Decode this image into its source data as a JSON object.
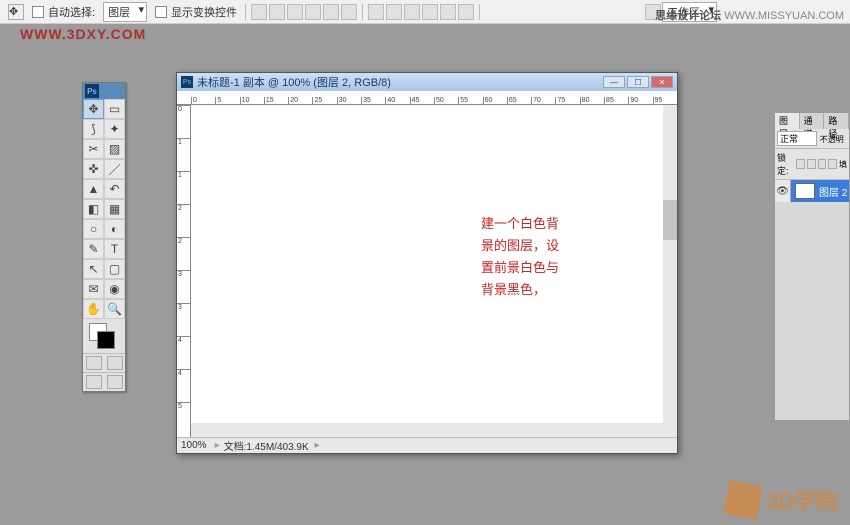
{
  "optionsBar": {
    "autoSelect": "自动选择:",
    "layerDropdown": "图层",
    "showTransform": "显示变换控件",
    "workspace": "工作区"
  },
  "watermarks": {
    "left": "WWW.3DXY.COM",
    "rightBold": "思缘设计论坛",
    "rightUrl": "WWW.MISSYUAN.COM"
  },
  "toolbox": {
    "headerLabel": "Ps",
    "fgColor": "#ffffff",
    "bgColor": "#000000"
  },
  "document": {
    "title": "未标题-1 副本 @ 100% (图层 2, RGB/8)",
    "rulerH": [
      "0",
      "5",
      "10",
      "15",
      "20",
      "25",
      "30",
      "35",
      "40",
      "45",
      "50",
      "55",
      "60",
      "65",
      "70",
      "75",
      "80",
      "85",
      "90",
      "95"
    ],
    "rulerV": [
      "0",
      "1",
      "1",
      "2",
      "2",
      "3",
      "3",
      "4",
      "4",
      "5"
    ],
    "annotation": "建一个白色背\n景的图层，设\n置前景白色与\n背景黑色，",
    "zoom": "100%",
    "fileInfo": "文档:1.45M/403.9K"
  },
  "layersPanel": {
    "tabs": [
      "图层",
      "通道",
      "路径"
    ],
    "blendMode": "正常",
    "opacityLabel": "不透明",
    "lockLabel": "锁定:",
    "fillLabel": "填",
    "layer": {
      "name": "图层 2"
    }
  },
  "logo3d": "3D学院"
}
